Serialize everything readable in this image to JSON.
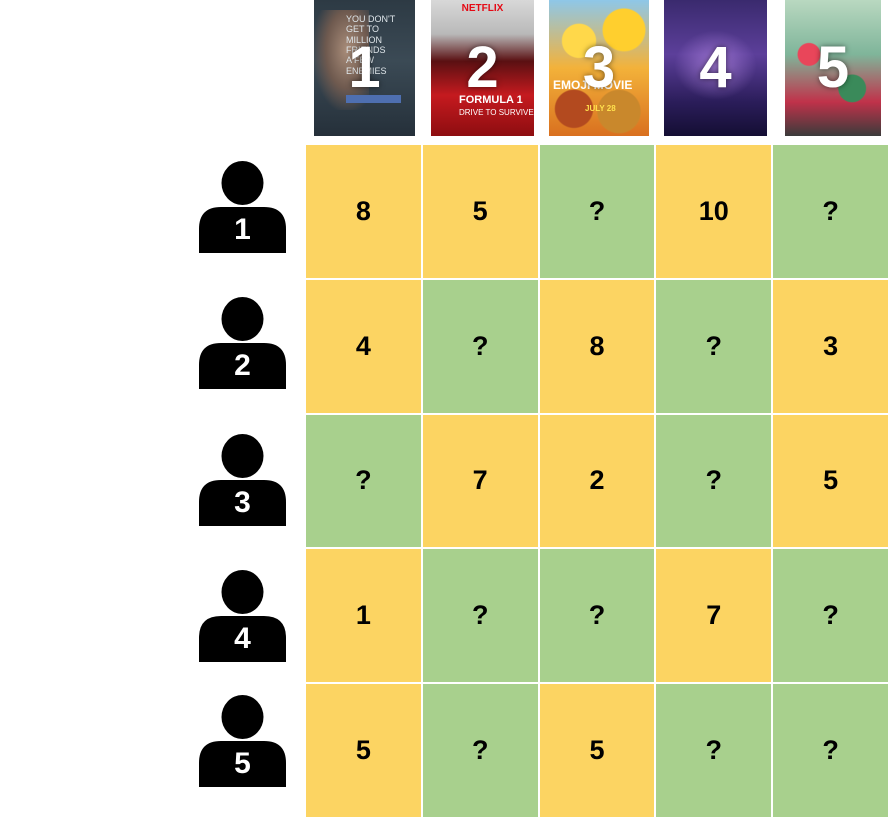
{
  "colors": {
    "known": "#fcd462",
    "unknown": "#a8d08d"
  },
  "posters": [
    {
      "number": "1",
      "lines": [
        "YOU DON'T",
        "GET TO",
        "MILLION",
        "FRIENDS",
        "A FEW",
        "ENEMIES"
      ]
    },
    {
      "number": "2",
      "brand": "NETFLIX",
      "title": "FORMULA 1",
      "subtitle": "DRIVE TO SURVIVE"
    },
    {
      "number": "3",
      "title": "EMOJI MOVIE",
      "subtitle": "JULY 28"
    },
    {
      "number": "4"
    },
    {
      "number": "5"
    }
  ],
  "users": [
    "1",
    "2",
    "3",
    "4",
    "5"
  ],
  "ratings": [
    [
      "8",
      "5",
      "?",
      "10",
      "?"
    ],
    [
      "4",
      "?",
      "8",
      "?",
      "3"
    ],
    [
      "?",
      "7",
      "2",
      "?",
      "5"
    ],
    [
      "1",
      "?",
      "?",
      "7",
      "?"
    ],
    [
      "5",
      "?",
      "5",
      "?",
      "?"
    ]
  ]
}
